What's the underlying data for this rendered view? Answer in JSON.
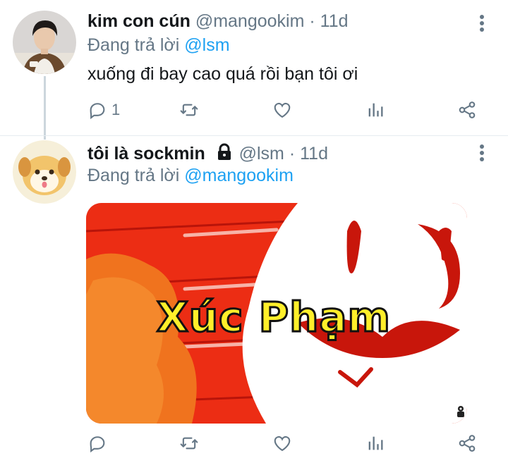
{
  "tweets": [
    {
      "name": "kim con cún",
      "handle": "@mangookim",
      "separator": "·",
      "time": "11d",
      "reply_prefix": "Đang trả lời",
      "reply_to": "@lsm",
      "text": "xuống đi bay cao quá rồi bạn tôi ơi",
      "reply_count": "1",
      "avatar_icon": "person-photo-icon"
    },
    {
      "name": "tôi là sockmin",
      "handle": "@lsm",
      "separator": "·",
      "time": "11d",
      "reply_prefix": "Đang trả lời",
      "reply_to": "@mangookim",
      "media_caption": "Xúc Phạm",
      "locked_icon": "lock-icon",
      "avatar_icon": "cartoon-dog-icon"
    }
  ],
  "colors": {
    "accent": "#1da1f2",
    "muted": "#657786",
    "text": "#14171a",
    "media_red": "#e8200c"
  },
  "action_icons": [
    "reply-icon",
    "retweet-icon",
    "like-icon",
    "analytics-icon",
    "share-icon"
  ]
}
